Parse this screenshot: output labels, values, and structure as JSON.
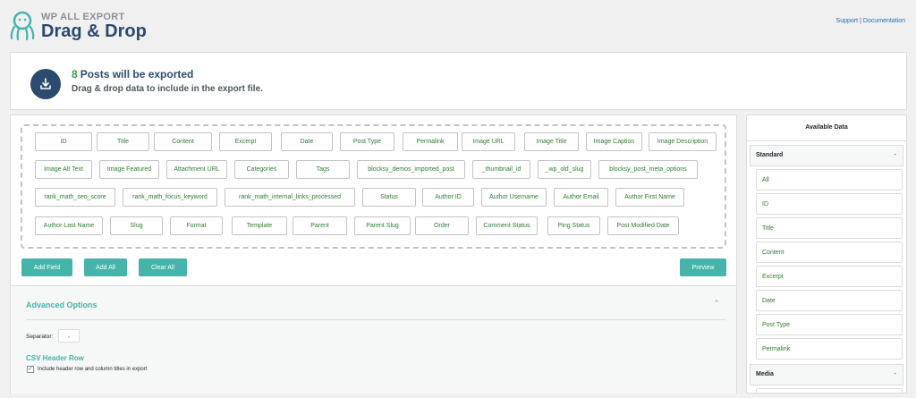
{
  "brand": {
    "top": "WP ALL EXPORT",
    "main": "Drag & Drop",
    "icon": "octopus-logo-icon"
  },
  "links": {
    "support": "Support",
    "separator": "|",
    "documentation": "Documentation"
  },
  "info": {
    "count": "8",
    "headline": "Posts will be exported",
    "subline": "Drag & drop data to include in the export file.",
    "icon": "export-download-icon"
  },
  "fields": [
    "ID",
    "Title",
    "Content",
    "Excerpt",
    "Date",
    "Post Type",
    "Permalink",
    "Image URL",
    "Image Title",
    "Image Caption",
    "Image Description",
    "Image Alt Text",
    "Image Featured",
    "Attachment URL",
    "Categories",
    "Tags",
    "blocksy_demos_imported_post",
    "_thumbnail_id",
    "_wp_old_slug",
    "blocksy_post_meta_options",
    "rank_math_seo_score",
    "rank_math_focus_keyword",
    "rank_math_internal_links_processed",
    "Status",
    "Author ID",
    "Author Username",
    "Author Email",
    "Author First Name",
    "Author Last Name",
    "Slug",
    "Format",
    "Template",
    "Parent",
    "Parent Slug",
    "Order",
    "Comment Status",
    "Ping Status",
    "Post Modified Date"
  ],
  "buttons": {
    "add_field": "Add Field",
    "add_all": "Add All",
    "clear_all": "Clear All",
    "preview": "Preview"
  },
  "advanced": {
    "title": "Advanced Options",
    "chevron": "^",
    "separator_label": "Separator:",
    "separator_value": ",",
    "csv_title": "CSV Header Row",
    "csv_checkbox_label": "Include header row and column titles in export",
    "csv_checked": true
  },
  "sidebar": {
    "title": "Available Data",
    "standard_label": "Standard",
    "standard_toggle": "-",
    "items": [
      "All",
      "ID",
      "Title",
      "Content",
      "Excerpt",
      "Date",
      "Post Type",
      "Permalink"
    ],
    "media_label": "Media",
    "media_toggle": "-"
  },
  "colors": {
    "accent": "#46b4aa",
    "brand": "#2c4a6e",
    "count": "#3ba33d",
    "field_text": "#2e7d32"
  }
}
